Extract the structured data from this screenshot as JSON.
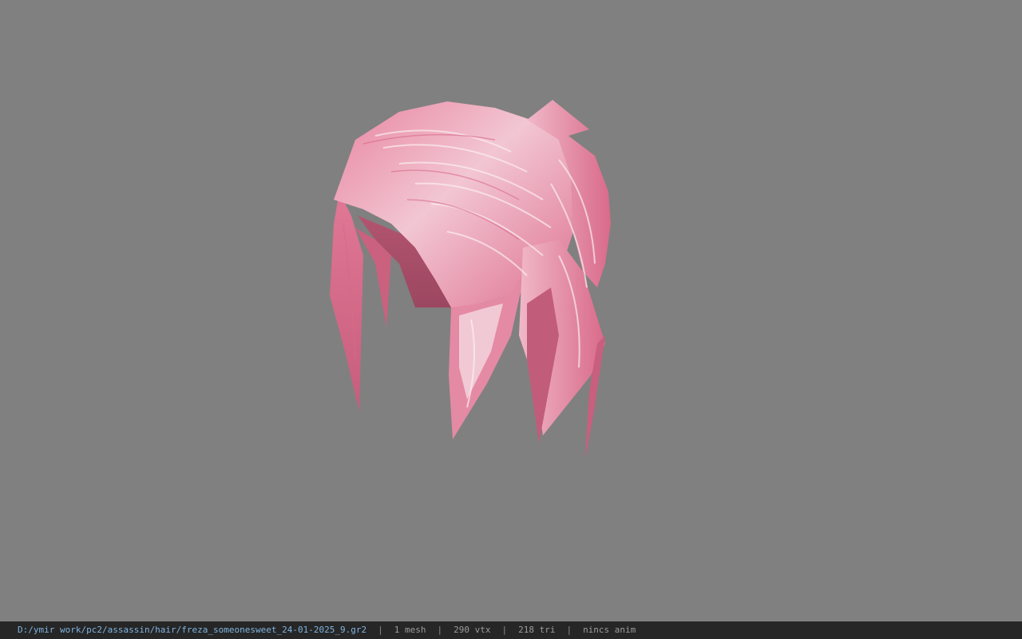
{
  "viewport": {
    "background_color": "#808080",
    "model": {
      "icon": "pink-hair-mesh",
      "base_color": "#e17a98",
      "highlight_color": "#f3e8ec",
      "shadow_color": "#b04e6a"
    }
  },
  "status_bar": {
    "file_path": "D:/ymir work/pc2/assassin/hair/freza_someonesweet_24-01-2025_9.gr2",
    "separator": "|",
    "mesh_count": "1 mesh",
    "vertex_count": "290 vtx",
    "triangle_count": "218 tri",
    "anim_status": "nincs anim"
  }
}
